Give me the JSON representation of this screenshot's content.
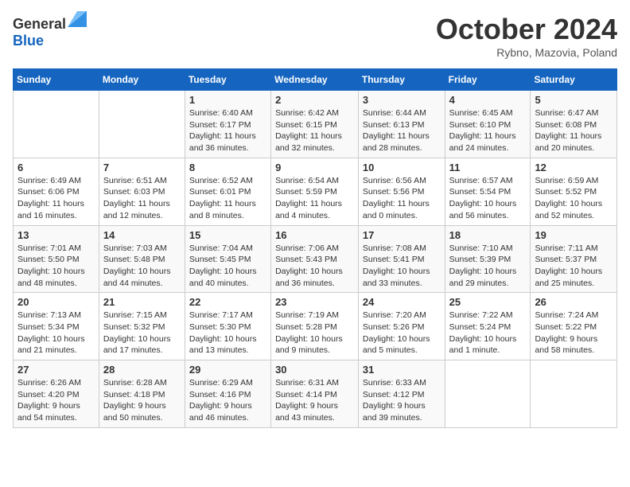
{
  "header": {
    "logo_general": "General",
    "logo_blue": "Blue",
    "month": "October 2024",
    "location": "Rybno, Mazovia, Poland"
  },
  "days_of_week": [
    "Sunday",
    "Monday",
    "Tuesday",
    "Wednesday",
    "Thursday",
    "Friday",
    "Saturday"
  ],
  "weeks": [
    [
      {
        "day": "",
        "sunrise": "",
        "sunset": "",
        "daylight": ""
      },
      {
        "day": "",
        "sunrise": "",
        "sunset": "",
        "daylight": ""
      },
      {
        "day": "1",
        "sunrise": "Sunrise: 6:40 AM",
        "sunset": "Sunset: 6:17 PM",
        "daylight": "Daylight: 11 hours and 36 minutes."
      },
      {
        "day": "2",
        "sunrise": "Sunrise: 6:42 AM",
        "sunset": "Sunset: 6:15 PM",
        "daylight": "Daylight: 11 hours and 32 minutes."
      },
      {
        "day": "3",
        "sunrise": "Sunrise: 6:44 AM",
        "sunset": "Sunset: 6:13 PM",
        "daylight": "Daylight: 11 hours and 28 minutes."
      },
      {
        "day": "4",
        "sunrise": "Sunrise: 6:45 AM",
        "sunset": "Sunset: 6:10 PM",
        "daylight": "Daylight: 11 hours and 24 minutes."
      },
      {
        "day": "5",
        "sunrise": "Sunrise: 6:47 AM",
        "sunset": "Sunset: 6:08 PM",
        "daylight": "Daylight: 11 hours and 20 minutes."
      }
    ],
    [
      {
        "day": "6",
        "sunrise": "Sunrise: 6:49 AM",
        "sunset": "Sunset: 6:06 PM",
        "daylight": "Daylight: 11 hours and 16 minutes."
      },
      {
        "day": "7",
        "sunrise": "Sunrise: 6:51 AM",
        "sunset": "Sunset: 6:03 PM",
        "daylight": "Daylight: 11 hours and 12 minutes."
      },
      {
        "day": "8",
        "sunrise": "Sunrise: 6:52 AM",
        "sunset": "Sunset: 6:01 PM",
        "daylight": "Daylight: 11 hours and 8 minutes."
      },
      {
        "day": "9",
        "sunrise": "Sunrise: 6:54 AM",
        "sunset": "Sunset: 5:59 PM",
        "daylight": "Daylight: 11 hours and 4 minutes."
      },
      {
        "day": "10",
        "sunrise": "Sunrise: 6:56 AM",
        "sunset": "Sunset: 5:56 PM",
        "daylight": "Daylight: 11 hours and 0 minutes."
      },
      {
        "day": "11",
        "sunrise": "Sunrise: 6:57 AM",
        "sunset": "Sunset: 5:54 PM",
        "daylight": "Daylight: 10 hours and 56 minutes."
      },
      {
        "day": "12",
        "sunrise": "Sunrise: 6:59 AM",
        "sunset": "Sunset: 5:52 PM",
        "daylight": "Daylight: 10 hours and 52 minutes."
      }
    ],
    [
      {
        "day": "13",
        "sunrise": "Sunrise: 7:01 AM",
        "sunset": "Sunset: 5:50 PM",
        "daylight": "Daylight: 10 hours and 48 minutes."
      },
      {
        "day": "14",
        "sunrise": "Sunrise: 7:03 AM",
        "sunset": "Sunset: 5:48 PM",
        "daylight": "Daylight: 10 hours and 44 minutes."
      },
      {
        "day": "15",
        "sunrise": "Sunrise: 7:04 AM",
        "sunset": "Sunset: 5:45 PM",
        "daylight": "Daylight: 10 hours and 40 minutes."
      },
      {
        "day": "16",
        "sunrise": "Sunrise: 7:06 AM",
        "sunset": "Sunset: 5:43 PM",
        "daylight": "Daylight: 10 hours and 36 minutes."
      },
      {
        "day": "17",
        "sunrise": "Sunrise: 7:08 AM",
        "sunset": "Sunset: 5:41 PM",
        "daylight": "Daylight: 10 hours and 33 minutes."
      },
      {
        "day": "18",
        "sunrise": "Sunrise: 7:10 AM",
        "sunset": "Sunset: 5:39 PM",
        "daylight": "Daylight: 10 hours and 29 minutes."
      },
      {
        "day": "19",
        "sunrise": "Sunrise: 7:11 AM",
        "sunset": "Sunset: 5:37 PM",
        "daylight": "Daylight: 10 hours and 25 minutes."
      }
    ],
    [
      {
        "day": "20",
        "sunrise": "Sunrise: 7:13 AM",
        "sunset": "Sunset: 5:34 PM",
        "daylight": "Daylight: 10 hours and 21 minutes."
      },
      {
        "day": "21",
        "sunrise": "Sunrise: 7:15 AM",
        "sunset": "Sunset: 5:32 PM",
        "daylight": "Daylight: 10 hours and 17 minutes."
      },
      {
        "day": "22",
        "sunrise": "Sunrise: 7:17 AM",
        "sunset": "Sunset: 5:30 PM",
        "daylight": "Daylight: 10 hours and 13 minutes."
      },
      {
        "day": "23",
        "sunrise": "Sunrise: 7:19 AM",
        "sunset": "Sunset: 5:28 PM",
        "daylight": "Daylight: 10 hours and 9 minutes."
      },
      {
        "day": "24",
        "sunrise": "Sunrise: 7:20 AM",
        "sunset": "Sunset: 5:26 PM",
        "daylight": "Daylight: 10 hours and 5 minutes."
      },
      {
        "day": "25",
        "sunrise": "Sunrise: 7:22 AM",
        "sunset": "Sunset: 5:24 PM",
        "daylight": "Daylight: 10 hours and 1 minute."
      },
      {
        "day": "26",
        "sunrise": "Sunrise: 7:24 AM",
        "sunset": "Sunset: 5:22 PM",
        "daylight": "Daylight: 9 hours and 58 minutes."
      }
    ],
    [
      {
        "day": "27",
        "sunrise": "Sunrise: 6:26 AM",
        "sunset": "Sunset: 4:20 PM",
        "daylight": "Daylight: 9 hours and 54 minutes."
      },
      {
        "day": "28",
        "sunrise": "Sunrise: 6:28 AM",
        "sunset": "Sunset: 4:18 PM",
        "daylight": "Daylight: 9 hours and 50 minutes."
      },
      {
        "day": "29",
        "sunrise": "Sunrise: 6:29 AM",
        "sunset": "Sunset: 4:16 PM",
        "daylight": "Daylight: 9 hours and 46 minutes."
      },
      {
        "day": "30",
        "sunrise": "Sunrise: 6:31 AM",
        "sunset": "Sunset: 4:14 PM",
        "daylight": "Daylight: 9 hours and 43 minutes."
      },
      {
        "day": "31",
        "sunrise": "Sunrise: 6:33 AM",
        "sunset": "Sunset: 4:12 PM",
        "daylight": "Daylight: 9 hours and 39 minutes."
      },
      {
        "day": "",
        "sunrise": "",
        "sunset": "",
        "daylight": ""
      },
      {
        "day": "",
        "sunrise": "",
        "sunset": "",
        "daylight": ""
      }
    ]
  ]
}
